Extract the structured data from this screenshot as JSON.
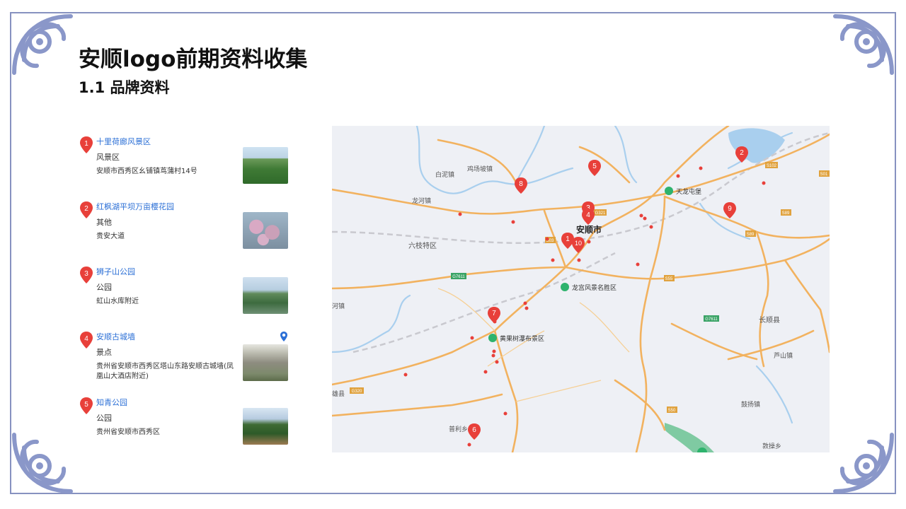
{
  "header": {
    "title": "安顺logo前期资料收集",
    "subtitle": "1.1 品牌资料"
  },
  "colors": {
    "frame": "#8792c0",
    "ornament": "#8a97c9",
    "pin": "#e8403a",
    "link": "#2b6fd6",
    "road": "#f2b25f",
    "water": "#a9cfee",
    "scenic": "#2eb36d"
  },
  "poi_list": [
    {
      "num": "1",
      "name": "十里荷廊风景区",
      "category": "风景区",
      "address": "安顺市西秀区幺铺镇茑蒲村14号",
      "thumb": "lotus-field-photo"
    },
    {
      "num": "2",
      "name": "红枫湖平坝万亩樱花园",
      "category": "其他",
      "address": "贵安大道",
      "thumb": "cherry-blossom-photo"
    },
    {
      "num": "3",
      "name": "狮子山公园",
      "category": "公园",
      "address": "虹山水库附近",
      "thumb": "mountain-park-photo"
    },
    {
      "num": "4",
      "name": "安顺古城墙",
      "category": "景点",
      "address": "贵州省安顺市西秀区塔山东路安顺古城墙(凤凰山大酒店附近)",
      "thumb": "city-wall-photo"
    },
    {
      "num": "5",
      "name": "知青公园",
      "category": "公园",
      "address": "贵州省安顺市西秀区",
      "thumb": "pavilion-photo"
    }
  ],
  "map": {
    "place_labels": [
      "白泥镇",
      "鸡场坡镇",
      "龙河镇",
      "六枝特区",
      "安顺市",
      "长顺县",
      "芦山镇",
      "鼓扬镇",
      "普利乡",
      "敦操乡",
      "河镇",
      "雄县"
    ],
    "scenic_labels": [
      "天龙屯堡",
      "龙宫风景名胜区",
      "黄果树瀑布景区"
    ],
    "road_labels": [
      "G321",
      "S102",
      "S01",
      "S89",
      "S89",
      "S03",
      "G7611",
      "S55",
      "G7611",
      "S50",
      "G320"
    ],
    "pins": [
      "1",
      "2",
      "3",
      "4",
      "5",
      "6",
      "7",
      "8",
      "9",
      "10"
    ]
  }
}
